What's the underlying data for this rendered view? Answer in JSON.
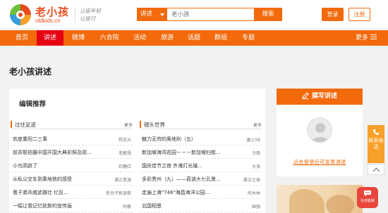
{
  "header": {
    "logo_cn": "老小孩",
    "logo_en": "oldkids.cn",
    "slogan_line1": "让座年轻",
    "slogan_line2": "让座行",
    "search_select": "讲述",
    "search_placeholder": "老小孩",
    "search_button": "搜索",
    "login_button": "登录",
    "register_button": "注册"
  },
  "nav": {
    "items": [
      "首页",
      "讲述",
      "微博",
      "六合院",
      "活动",
      "旅游",
      "话题",
      "群组",
      "专题"
    ],
    "active": "讲述",
    "more_label": "更多"
  },
  "page": {
    "title": "老小孩讲述"
  },
  "editor_picks": {
    "title": "编辑推荐",
    "left": {
      "name": "过往足迹",
      "more": "更多",
      "rows": [
        {
          "title": "欢度重阳二三事",
          "author": "杨克元"
        },
        {
          "title": "前苏联拍摄中国开国大典彩照及视...",
          "author": "老教授"
        },
        {
          "title": "小鸟高龄了",
          "author": "石糖红"
        },
        {
          "title": "从私公交车到乘地铁的感受",
          "author": "浦江恩源"
        },
        {
          "title": "看子弟兵威武雄壮 忆反...",
          "author": "老舟子新放歌"
        },
        {
          "title": "一幅让我记忆犹新的宣传画",
          "author": "同泰"
        }
      ]
    },
    "right": {
      "name": "镜头世界",
      "more": "更多",
      "rows": [
        {
          "title": "魅力无穷的奥地利（五）",
          "author": "童心58"
        },
        {
          "title": "新加坡海湾花园－－－新加坡扫街...",
          "author": "冷艳"
        },
        {
          "title": "国庆佳节之夜 外滩灯光璀...",
          "author": "大海"
        },
        {
          "title": "多彩贵州（九）——荔波大七孔景...",
          "author": "晨兰之珠"
        },
        {
          "title": "走遍上海\"746\"海昌海洋公园...",
          "author": "阿木林"
        },
        {
          "title": "北国相思",
          "author": "国强"
        }
      ]
    }
  },
  "sidebar": {
    "write_button": "撰写讲述",
    "login_link": "点击登录后可发表讲述"
  },
  "floating": {
    "contact_label": "联系电话",
    "chat_label": "在线客服"
  },
  "colors": {
    "brand_orange": "#f26a0c",
    "active_red": "#e60012"
  }
}
